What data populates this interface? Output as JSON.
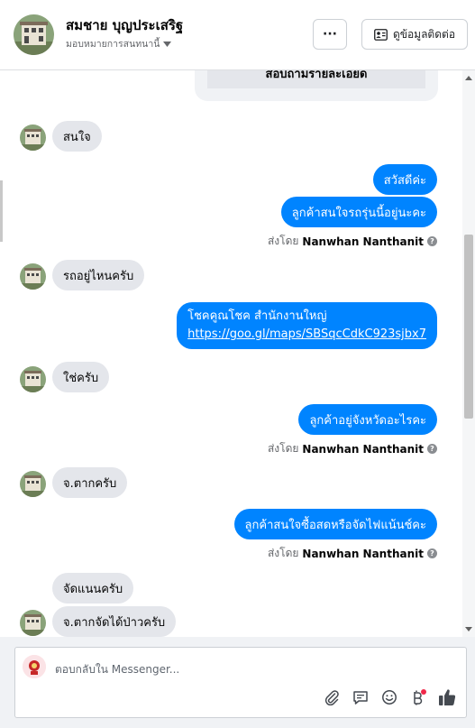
{
  "header": {
    "name": "สมชาย บุญประเสริฐ",
    "assign_label": "มอบหมายการสนทนานี้",
    "more_label": "···",
    "contact_label": "ดูข้อมูลติดต่อ"
  },
  "card": {
    "button_label": "สอบถามรายละเอียด"
  },
  "messages": [
    {
      "text": "สนใจ"
    },
    {
      "text": "สวัสดีค่ะ"
    },
    {
      "text": "ลูกค้าสนใจรถรุ่นนี้อยู่นะคะ"
    },
    {
      "text": "รถอยู่ไหนครับ"
    },
    {
      "text": "โชคคูณโชค สำนักงานใหญ่",
      "link": "https://goo.gl/maps/SBSqcCdkC923sjbx7"
    },
    {
      "text": "ใช่ครับ"
    },
    {
      "text": "ลูกค้าอยู่จังหวัดอะไรคะ"
    },
    {
      "text": "จ.ตากครับ"
    },
    {
      "text": "ลูกค้าสนใจซื้อสดหรือจัดไฟแน้นช์คะ"
    },
    {
      "text": "จัดแนนครับ"
    },
    {
      "text": "จ.ตากจัดได้ป่าวครับ"
    }
  ],
  "sent_by": {
    "prefix": "ส่งโดย",
    "agent": "Nanwhan Nanthanit",
    "help": "?"
  },
  "composer": {
    "placeholder": "ตอบกลับใน Messenger..."
  },
  "colors": {
    "outgoing": "#0084ff",
    "incoming": "#e4e6eb",
    "notification_dot": "#f02849"
  },
  "icons": [
    "paperclip-icon",
    "quick-reply-icon",
    "emoji-icon",
    "baht-icon",
    "thumbs-up-icon",
    "chevron-down-icon",
    "contact-card-icon"
  ]
}
